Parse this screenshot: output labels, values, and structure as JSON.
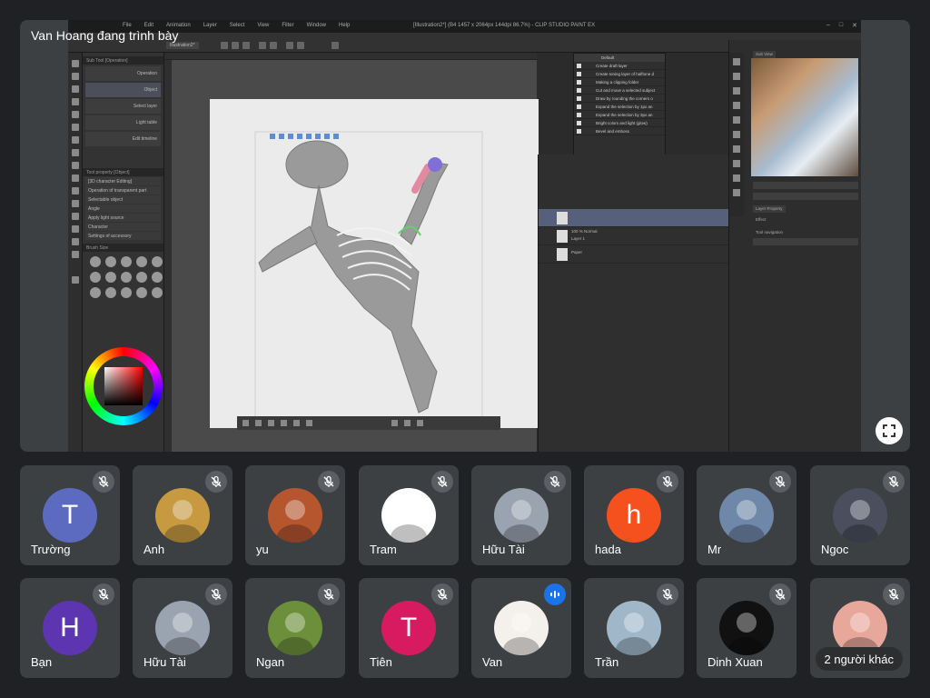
{
  "presenter": {
    "label": "Van Hoang đang trình bày",
    "fullscreen_icon": "fullscreen-icon"
  },
  "shared_screen": {
    "app_title": "[Illustration2*] (B4 1457 x 2064px 144dpi 86.7%) - CLIP STUDIO PAINT EX",
    "menus": [
      "File",
      "Edit",
      "Animation",
      "Layer",
      "Select",
      "View",
      "Filter",
      "Window",
      "Help"
    ],
    "window_controls": [
      "–",
      "□",
      "✕"
    ],
    "tab_label": "Illustration2*",
    "left_panel": {
      "header": "Sub Tool [Operation]",
      "subtools": [
        "Operation",
        "Object",
        "Select layer",
        "Light table",
        "Edit timeline"
      ],
      "tool_property_header": "Tool property [Object]",
      "properties": [
        "[3D character Editing]",
        "Operation of transparent part",
        "Selectable object",
        "Angle",
        "Apply light source",
        "Character",
        "Settings of accessory"
      ],
      "brush_size_header": "Brush Size"
    },
    "auto_actions": {
      "header": "Auto Action",
      "set_name": "Default",
      "items": [
        "Create draft layer",
        "Create toning layer of halftone d",
        "Making a clipping folder",
        "Cut and move a selected subject",
        "Draw by rounding the corners o",
        "Expand the selection by 1px an",
        "Expand the selection by 3px an",
        "Bright colors and light (glow)",
        "Bevel and emboss"
      ]
    },
    "layers": {
      "items": [
        {
          "name": "",
          "blend": ""
        },
        {
          "name": "Layer 1",
          "blend": "100 % Normal"
        },
        {
          "name": "Paper",
          "blend": ""
        }
      ]
    },
    "right_panel": {
      "navigator_header": "Sub View",
      "layer_property_header": "Layer Property",
      "effect_label": "Effect",
      "tool_navigation_label": "Tool navigation"
    }
  },
  "participants": [
    {
      "name": "Trường",
      "type": "initial",
      "initial": "T",
      "color": "#5c6bc0",
      "mic": "muted"
    },
    {
      "name": "Anh",
      "type": "photo",
      "color": "#c79a42",
      "mic": "muted"
    },
    {
      "name": "yu",
      "type": "photo",
      "color": "#b5562f",
      "mic": "muted"
    },
    {
      "name": "Tram",
      "type": "photo",
      "color": "#ffffff",
      "mic": "muted"
    },
    {
      "name": "Hữu Tài",
      "type": "photo",
      "color": "#9aa3b0",
      "mic": "muted"
    },
    {
      "name": "hada",
      "type": "initial",
      "initial": "h",
      "color": "#f4511e",
      "mic": "muted"
    },
    {
      "name": "Mr",
      "type": "photo",
      "color": "#6f87a8",
      "mic": "muted"
    },
    {
      "name": "Ngoc",
      "type": "photo",
      "color": "#4a4f5e",
      "mic": "muted"
    },
    {
      "name": "Bạn",
      "type": "initial",
      "initial": "H",
      "color": "#5e35b1",
      "mic": "muted"
    },
    {
      "name": "Hữu Tài",
      "type": "photo",
      "color": "#9aa3b0",
      "mic": "muted"
    },
    {
      "name": "Ngan",
      "type": "photo",
      "color": "#6b8f3a",
      "mic": "muted"
    },
    {
      "name": "Tiên",
      "type": "initial",
      "initial": "T",
      "color": "#d81b60",
      "mic": "muted"
    },
    {
      "name": "Van",
      "type": "photo",
      "color": "#f4f1ec",
      "mic": "speaking"
    },
    {
      "name": "Trần",
      "type": "photo",
      "color": "#9fb7c9",
      "mic": "muted"
    },
    {
      "name": "Dinh Xuan",
      "type": "photo",
      "color": "#111111",
      "mic": "muted"
    },
    {
      "name": "",
      "type": "photo",
      "color": "#e7a79a",
      "mic": "muted",
      "more_label": "2 người khác"
    }
  ],
  "icons": {
    "muted_mic": "mic-off-icon",
    "speaking": "audio-level-icon"
  }
}
